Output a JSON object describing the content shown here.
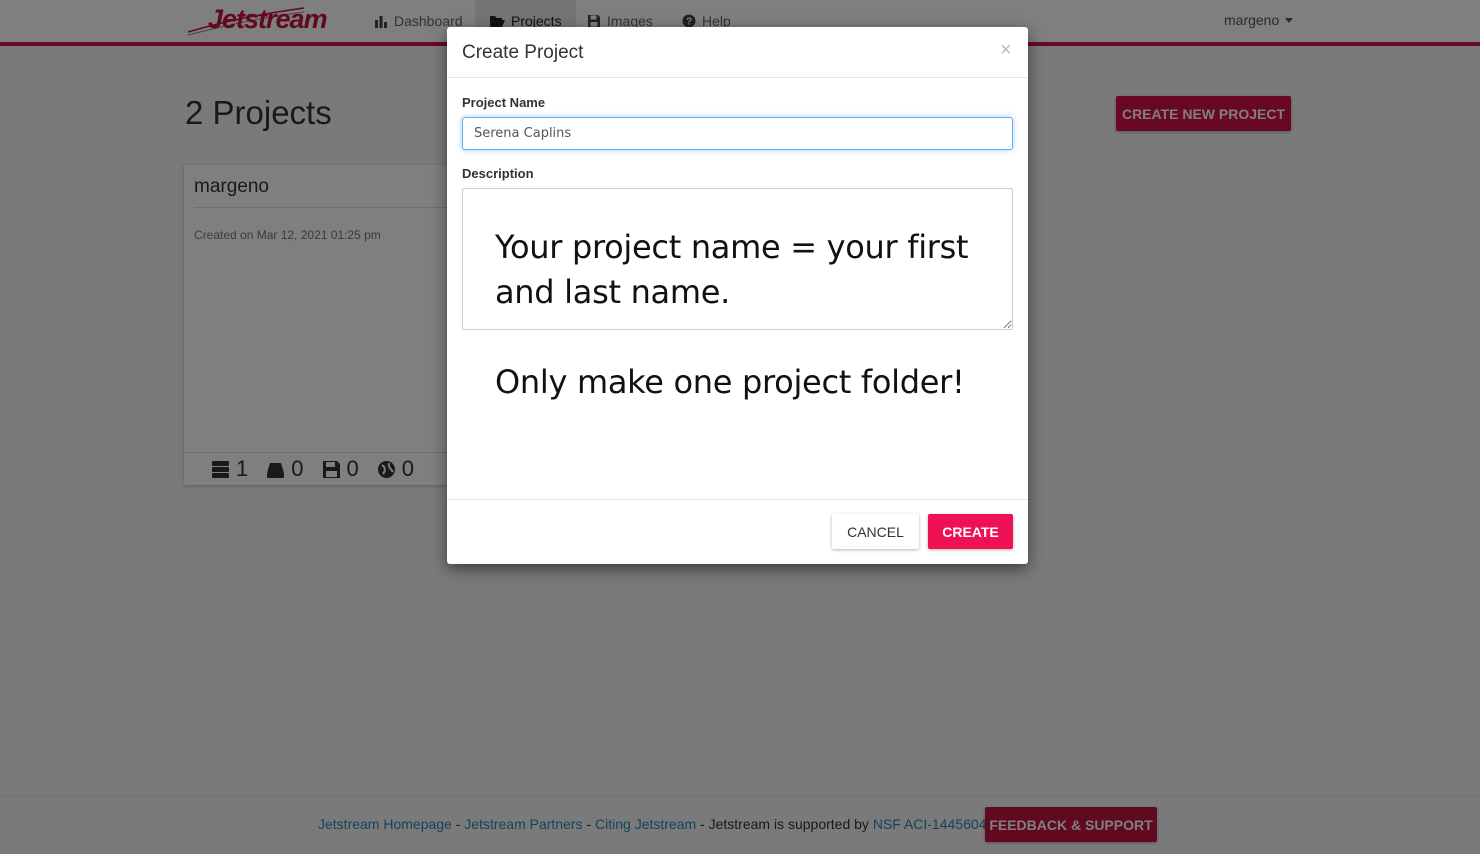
{
  "navbar": {
    "logo_text": "Jetstream",
    "items": [
      {
        "label": "Dashboard",
        "icon": "bar-chart-icon",
        "active": false
      },
      {
        "label": "Projects",
        "icon": "folder-open-icon",
        "active": true
      },
      {
        "label": "Images",
        "icon": "floppy-disk-icon",
        "active": false
      },
      {
        "label": "Help",
        "icon": "question-circle-icon",
        "active": false
      }
    ],
    "username": "margeno"
  },
  "page": {
    "title": "2 Projects",
    "create_new_label": "CREATE NEW PROJECT"
  },
  "project_card": {
    "name": "margeno",
    "created": "Created on Mar 12, 2021 01:25 pm",
    "stats": [
      {
        "icon": "server-stack-icon",
        "value": "1"
      },
      {
        "icon": "volume-icon",
        "value": "0"
      },
      {
        "icon": "floppy-disk-icon",
        "value": "0"
      },
      {
        "icon": "globe-icon",
        "value": "0"
      }
    ]
  },
  "modal": {
    "title": "Create Project",
    "close_glyph": "×",
    "name_label": "Project Name",
    "name_value": "Serena Caplins",
    "description_label": "Description",
    "description_value": "",
    "note_line1": "Your project name = your first",
    "note_line2": "and last name.",
    "note_line3": "Only make one project folder!",
    "cancel_label": "CANCEL",
    "create_label": "CREATE"
  },
  "footer": {
    "link1": "Jetstream Homepage",
    "sep1": " - ",
    "link2": "Jetstream Partners",
    "sep2": " - ",
    "link3": "Citing Jetstream",
    "supported_text": " - Jetstream is supported by ",
    "link4": "NSF ACI-1445604",
    "feedback_label": "FEEDBACK & SUPPORT"
  },
  "colors": {
    "brand": "#d31146",
    "primary_button": "#ee1153",
    "link": "#2a86b8"
  }
}
